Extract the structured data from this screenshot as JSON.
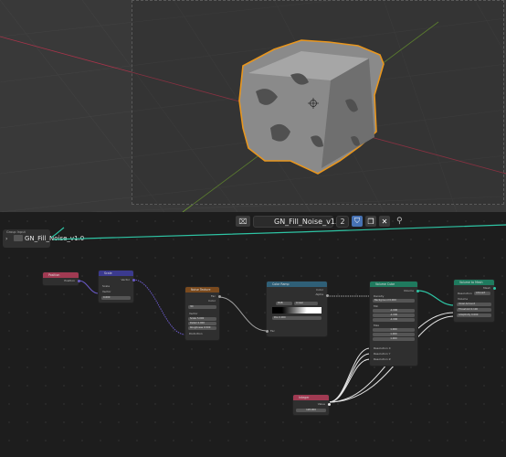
{
  "header": {
    "node_group_name": "GN_Fill_Noise_v1.0",
    "user_count": "2"
  },
  "group_panel": {
    "title": "Group Input",
    "label": "GN_Fill_Noise_v1.0"
  },
  "nodes": {
    "position": {
      "title": "Position",
      "output": "Position"
    },
    "scale": {
      "title": "Scale",
      "out": "Vector",
      "in1": "Vector",
      "in2": "Scale",
      "value": "0.600"
    },
    "noise": {
      "title": "Noise Texture",
      "out1": "Fac",
      "out2": "Color",
      "dim": "3D",
      "in_vector": "Vector",
      "scale_l": "Scale",
      "scale_v": "5.000",
      "detail_l": "Detail",
      "detail_v": "2.000",
      "rough_l": "Roughness",
      "rough_v": "0.500",
      "distortion": "Distortion"
    },
    "ramp": {
      "title": "Color Ramp",
      "out1": "Color",
      "out2": "Alpha",
      "mode": "RGB",
      "interp": "Linear",
      "pos_v": "0.000",
      "pos_l": "Pos",
      "fac": "Fac"
    },
    "volcube": {
      "title": "Volume Cube",
      "volume": "Volume",
      "density": "Density",
      "bg_l": "Background",
      "bg_v": "0.000",
      "min": "Min",
      "max": "Max",
      "min_x": "-1.000",
      "min_y": "-1.000",
      "min_z": "-1.000",
      "max_x": "1.000",
      "max_y": "1.000",
      "max_z": "1.000",
      "res_x": "Resolution X",
      "res_y": "Resolution Y",
      "res_z": "Resolution Z"
    },
    "v2m": {
      "title": "Volume to Mesh",
      "mesh": "Mesh",
      "resolution": "Resolution",
      "amount": "Amount",
      "volume": "Volume",
      "voxel": "Voxel Amount",
      "voxel_v": "64.000",
      "threshold": "Threshold",
      "threshold_v": "0.100",
      "adapt": "Adaptivity",
      "adapt_v": "0.000"
    },
    "integer": {
      "title": "Integer",
      "output": "Value",
      "value": "128,000"
    }
  },
  "colors": {
    "selection": "#e8961e",
    "link_green": "#2ec4a4",
    "vector_link": "#6a5ac8",
    "float_link": "#a0a0a0"
  }
}
